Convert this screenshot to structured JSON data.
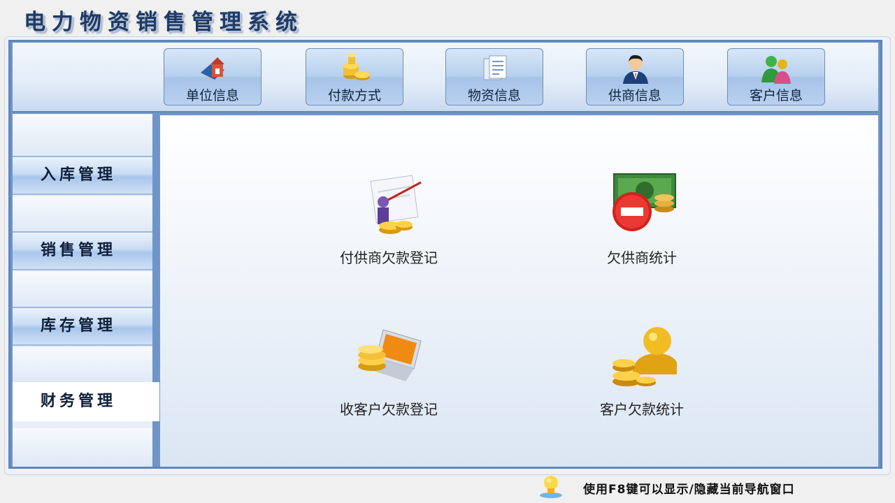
{
  "app": {
    "title": "电力物资销售管理系统"
  },
  "toolbar": {
    "buttons": [
      {
        "label": "单位信息",
        "icon": "building-icon"
      },
      {
        "label": "付款方式",
        "icon": "coins-icon"
      },
      {
        "label": "物资信息",
        "icon": "documents-icon"
      },
      {
        "label": "供商信息",
        "icon": "supplier-person-icon"
      },
      {
        "label": "客户信息",
        "icon": "customers-icon"
      }
    ]
  },
  "sidebar": {
    "items": [
      {
        "label": "入库管理",
        "active": false
      },
      {
        "label": "销售管理",
        "active": false
      },
      {
        "label": "库存管理",
        "active": false
      },
      {
        "label": "财务管理",
        "active": true
      }
    ]
  },
  "main": {
    "tiles": [
      {
        "label": "付供商欠款登记",
        "icon": "payment-chart-icon"
      },
      {
        "label": "欠供商统计",
        "icon": "money-minus-icon"
      },
      {
        "label": "收客户欠款登记",
        "icon": "laptop-coins-icon"
      },
      {
        "label": "客户欠款统计",
        "icon": "gold-person-icon"
      }
    ]
  },
  "status": {
    "hint": "使用F8键可以显示/隐藏当前导航窗口",
    "icon": "lightbulb-icon"
  },
  "colors": {
    "accent": "#5f86bd",
    "button_face": "#b7d0ee",
    "gold": "#e8b418",
    "title": "#1f3a66"
  }
}
